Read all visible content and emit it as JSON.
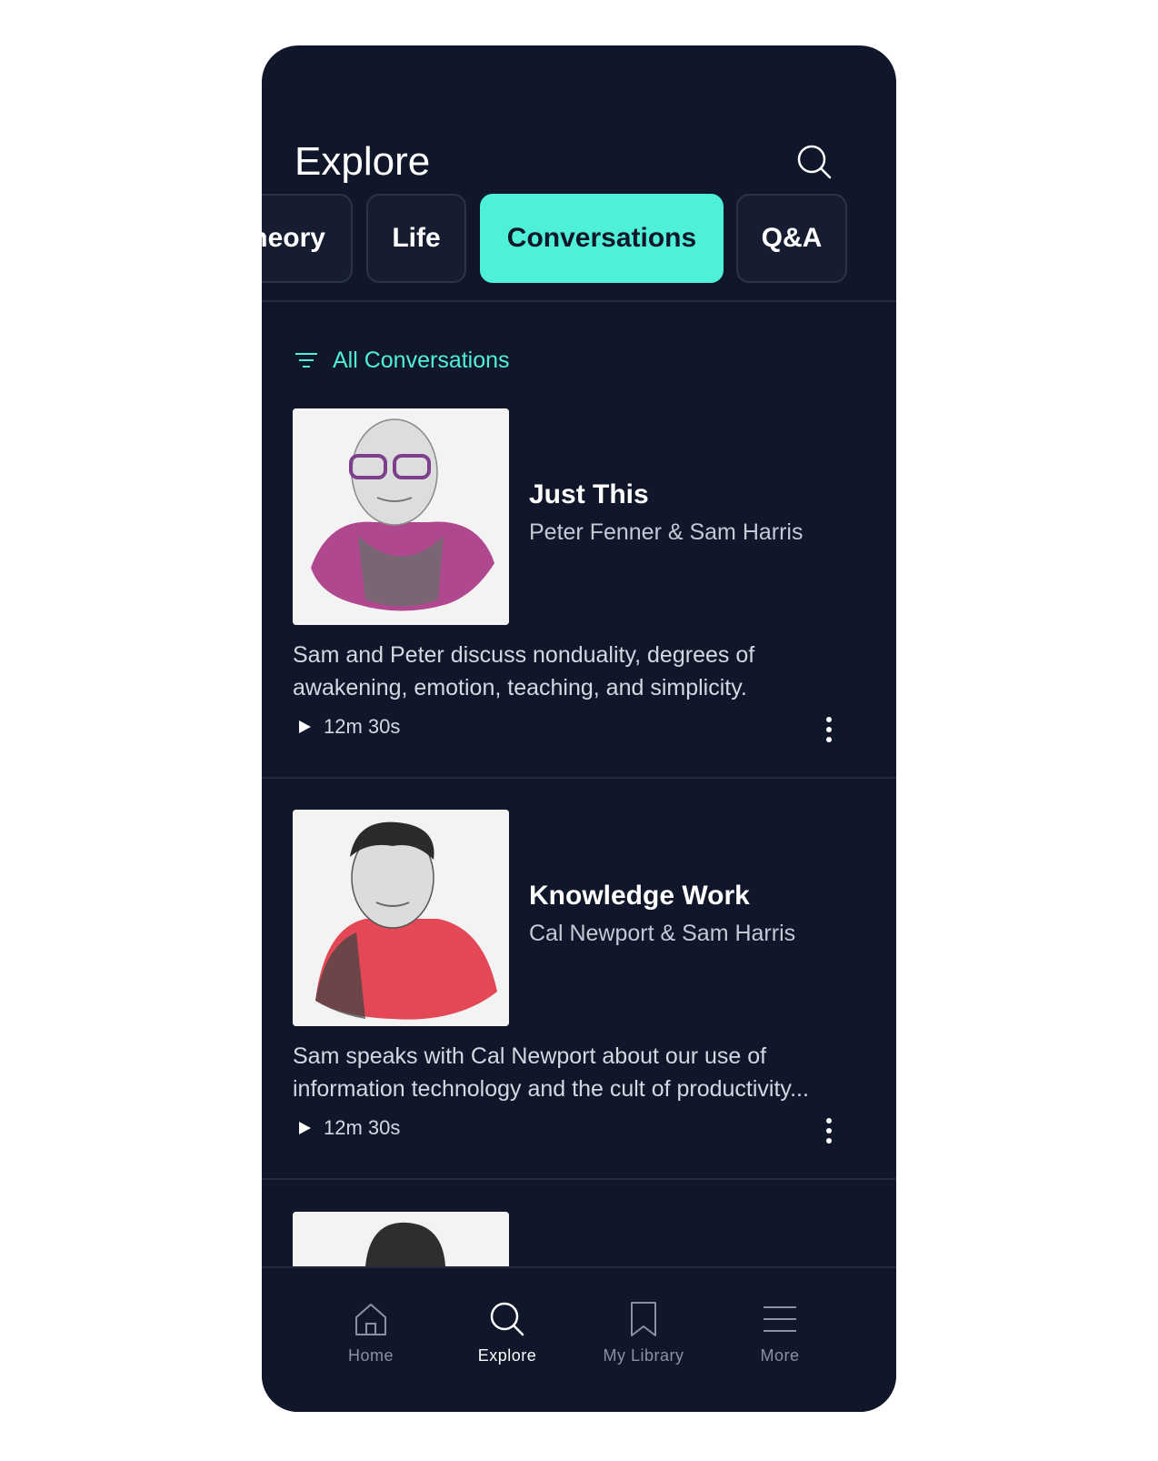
{
  "header": {
    "title": "Explore"
  },
  "icons": {
    "search": "search-icon",
    "filter": "filter-icon",
    "play": "play-icon",
    "more": "more-vertical-icon"
  },
  "tabs": [
    {
      "label": "heory"
    },
    {
      "label": "Life"
    },
    {
      "label": "Conversations",
      "active": true
    },
    {
      "label": "Q&A"
    }
  ],
  "filter": {
    "label": "All Conversations"
  },
  "cards": [
    {
      "title": "Just This",
      "subtitle": "Peter Fenner & Sam Harris",
      "description": "Sam and Peter discuss nonduality, degrees of awakening, emotion, teaching, and simplicity.",
      "duration": "12m 30s"
    },
    {
      "title": "Knowledge Work",
      "subtitle": "Cal Newport & Sam Harris",
      "description": "Sam speaks with Cal Newport about our use of information technology and the cult of productivity...",
      "duration": "12m 30s"
    }
  ],
  "nav": [
    {
      "label": "Home",
      "icon": "home-icon"
    },
    {
      "label": "Explore",
      "icon": "search-icon",
      "active": true
    },
    {
      "label": "My Library",
      "icon": "bookmark-icon"
    },
    {
      "label": "More",
      "icon": "menu-icon"
    }
  ],
  "colors": {
    "background": "#11172a",
    "accent": "#4ff0d8",
    "text": "#ffffff"
  }
}
